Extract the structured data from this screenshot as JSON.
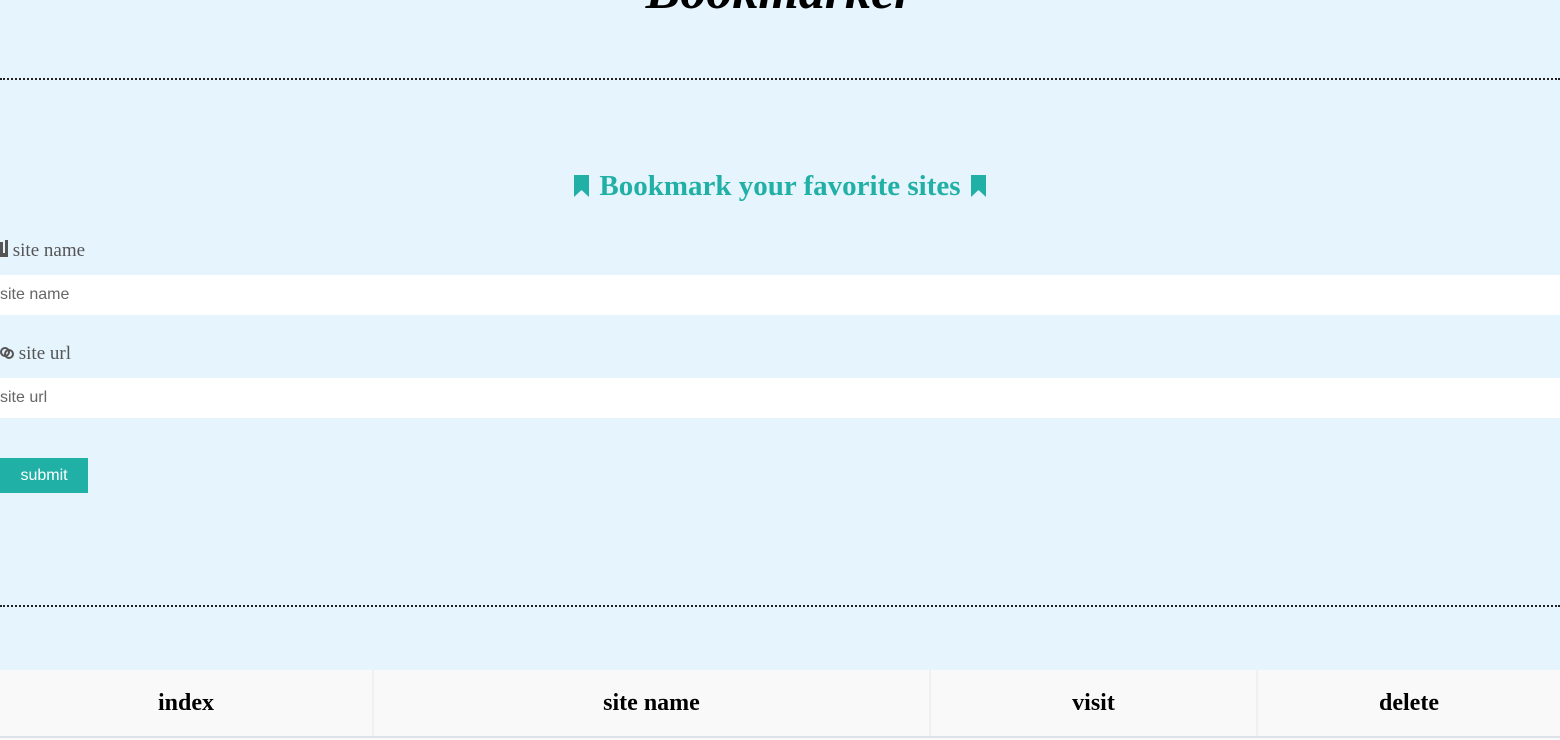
{
  "app": {
    "title": "Bookmarker"
  },
  "form": {
    "heading": "Bookmark your favorite sites",
    "heading_icon": "bookmark-icon",
    "site_name_label": "site name",
    "site_name_icon": "tag-icon",
    "site_name_placeholder": "site name",
    "site_url_label": "site url",
    "site_url_icon": "link-icon",
    "site_url_placeholder": "site url",
    "submit_label": "submit"
  },
  "table": {
    "columns": [
      "index",
      "site name",
      "visit",
      "delete"
    ]
  },
  "colors": {
    "accent": "#20b0a6",
    "background": "#e6f4fd",
    "label_text": "#555555"
  }
}
